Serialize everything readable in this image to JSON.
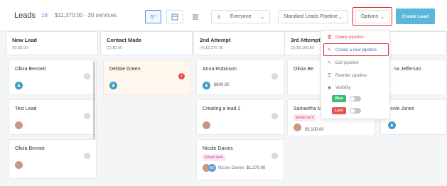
{
  "header": {
    "title": "Leads",
    "count": "16",
    "amount": "$11,370.00 · 30 services",
    "sort_icon": "sort-arrows-icon",
    "filter_select": "Everyone",
    "pipeline_select": "Standard Leads Pipeline",
    "options_label": "Options",
    "create_label": "Create Lead"
  },
  "columns": [
    {
      "name": "New Lead",
      "summary": "(5) $0.00",
      "cards": [
        {
          "name": "Olivia Bennett"
        },
        {
          "name": "Test Lead"
        },
        {
          "name": "Olivia Bennet"
        }
      ]
    },
    {
      "name": "Contact Made",
      "summary": "(1) $0.00",
      "cards": [
        {
          "name": "Debbie Green"
        }
      ]
    },
    {
      "name": "2nd Attempt",
      "summary": "(4) $2,375.00",
      "cards": [
        {
          "name": "Anna Robinson",
          "amount": "$800.00"
        },
        {
          "name": "Creating a lead 2"
        },
        {
          "name": "Nicole Davies",
          "tag": "Email sent",
          "assignees": "Nicole Davies",
          "initials": "ND",
          "amount": "$1,270.00"
        }
      ]
    },
    {
      "name": "3rd Attempt",
      "summary": "(2) $3,100.00",
      "cards": [
        {
          "name": "Olivia Be"
        },
        {
          "name": "Samantha M",
          "tag": "Email sent",
          "amount": "$3,100.00"
        }
      ]
    },
    {
      "name": "",
      "summary": "",
      "cards": [
        {
          "name": "na Jefferson"
        },
        {
          "name": "icole Jones"
        }
      ]
    }
  ],
  "menu": {
    "delete": "Delete pipeline",
    "create": "Create a new pipeline",
    "edit": "Edit pipeline",
    "reorder": "Reorder pipeline",
    "visibility": "Visibility",
    "won": "Won",
    "lost": "Lost"
  },
  "colors": {
    "accent": "#5cb5dc",
    "danger": "#e04e4e",
    "won": "#3dbb74",
    "lost": "#e9504f"
  }
}
